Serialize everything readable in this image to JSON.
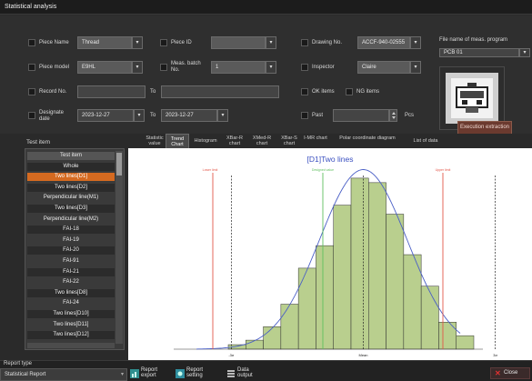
{
  "window": {
    "title": "Statistical analysis"
  },
  "filters": {
    "piece_name": {
      "label": "Piece Name",
      "value": "Thread"
    },
    "piece_id": {
      "label": "Piece ID",
      "value": ""
    },
    "drawing_no": {
      "label": "Drawing No.",
      "value": "ACCF-940-02555"
    },
    "piece_model": {
      "label": "Piece model",
      "value": "E9HL"
    },
    "meas_batch": {
      "label": "Meas. batch No.",
      "value": "1"
    },
    "inspector": {
      "label": "Inspector",
      "value": "Claire"
    },
    "record_no": {
      "label": "Record No.",
      "to": "To",
      "from_value": "",
      "to_value": ""
    },
    "ok_items": {
      "label": "OK items"
    },
    "ng_items": {
      "label": "NG items"
    },
    "designate_date": {
      "label": "Designate date",
      "from": "2023-12-27",
      "to_label": "To",
      "to": "2023-12-27"
    },
    "past": {
      "label": "Past",
      "value": "",
      "unit": "Pcs"
    },
    "file_name": {
      "label": "File name of meas. program",
      "value": "PCB 01"
    }
  },
  "execution_button": "Execution extraction",
  "test_item_header": "Test item",
  "tabs": [
    "Statistic value",
    "Trend Chart",
    "Histogram",
    "XBar-R chart",
    "XMed-R chart",
    "XBar-S chart",
    "I-MR chart",
    "Polar coordinate diagram",
    "List of data"
  ],
  "active_tab": "Trend Chart",
  "test_items": {
    "header": "Test item",
    "items": [
      "Whole",
      "Two lines[D1]",
      "Two lines[D2]",
      "Perpendicular line(M1)",
      "Two lines[D3]",
      "Perpendicular line(M2)",
      "FAI-18",
      "FAI-19",
      "FAI-20",
      "FAI-91",
      "FAI-21",
      "FAI-22",
      "Two lines[D8]",
      "FAI-24",
      "Two lines[D10]",
      "Two lines[D11]",
      "Two lines[D12]"
    ],
    "selected": "Two lines[D1]"
  },
  "chart_data": {
    "type": "bar",
    "title": "[D1]Two lines",
    "values": [
      1,
      2,
      5,
      10,
      18,
      23,
      32,
      38,
      37,
      30,
      21,
      14,
      6,
      3
    ],
    "ylim": [
      0,
      40
    ],
    "markers": {
      "lower_limit_label": "Lower limit",
      "upper_limit_label": "Upper limit",
      "designed_value_label": "Designed value",
      "minus_3s": "-3σ",
      "mean": "Mean",
      "plus_3s": "3σ"
    },
    "colors": {
      "bar": "#b9cf8e",
      "bar_edge": "#2e2e2e",
      "curve": "#4a5fc6",
      "limit": "#e4574a",
      "design": "#5fbf5f",
      "title": "#3a4fc0"
    }
  },
  "report": {
    "type_label": "Report type",
    "type_value": "Statistical Report",
    "export": "Report export",
    "setting": "Report setting",
    "data_output": "Data output",
    "close": "Close"
  }
}
